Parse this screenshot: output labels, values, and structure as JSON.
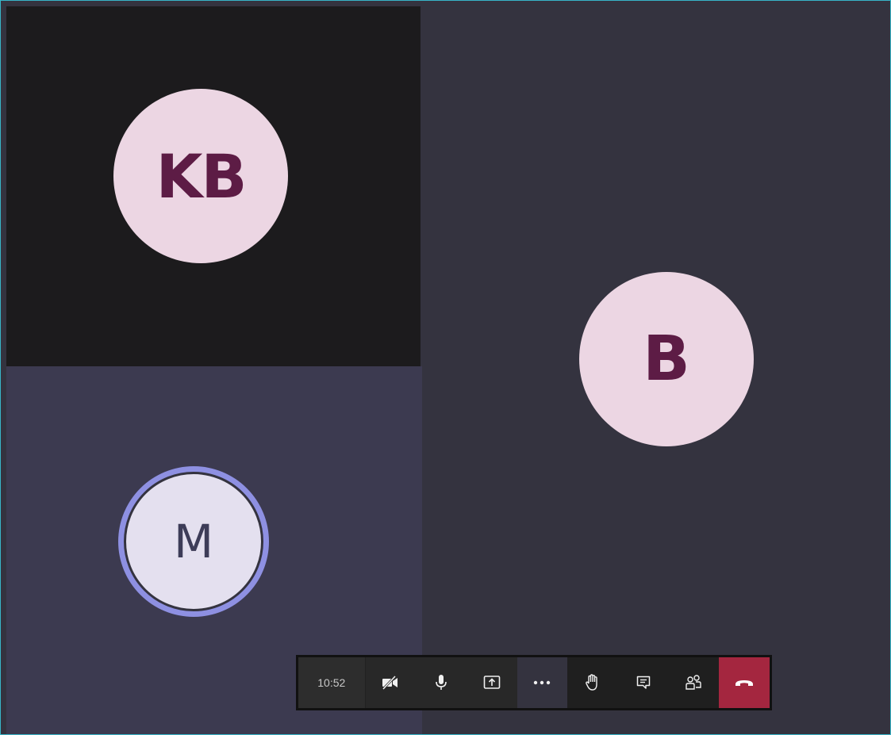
{
  "participants": {
    "kb": {
      "initials": "KB",
      "bg_color": "#ecd6e3",
      "text_color": "#5d1c45"
    },
    "m": {
      "initials": "M",
      "bg_color": "#e4e0ef",
      "text_color": "#3d3c58",
      "speaking_ring_color": "#8e90e2"
    },
    "b": {
      "initials": "B",
      "bg_color": "#ecd6e3",
      "text_color": "#5d1c45"
    }
  },
  "toolbar": {
    "call_duration": "10:52",
    "buttons": [
      {
        "name": "camera-off",
        "icon": "video-off-icon"
      },
      {
        "name": "microphone",
        "icon": "microphone-icon"
      },
      {
        "name": "share",
        "icon": "share-screen-icon"
      },
      {
        "name": "more",
        "icon": "more-options-icon"
      },
      {
        "name": "raise-hand",
        "icon": "raise-hand-icon"
      },
      {
        "name": "chat",
        "icon": "chat-icon"
      },
      {
        "name": "participants",
        "icon": "people-icon"
      },
      {
        "name": "hang-up",
        "icon": "hang-up-icon"
      }
    ],
    "hangup_color": "#a4263f"
  }
}
